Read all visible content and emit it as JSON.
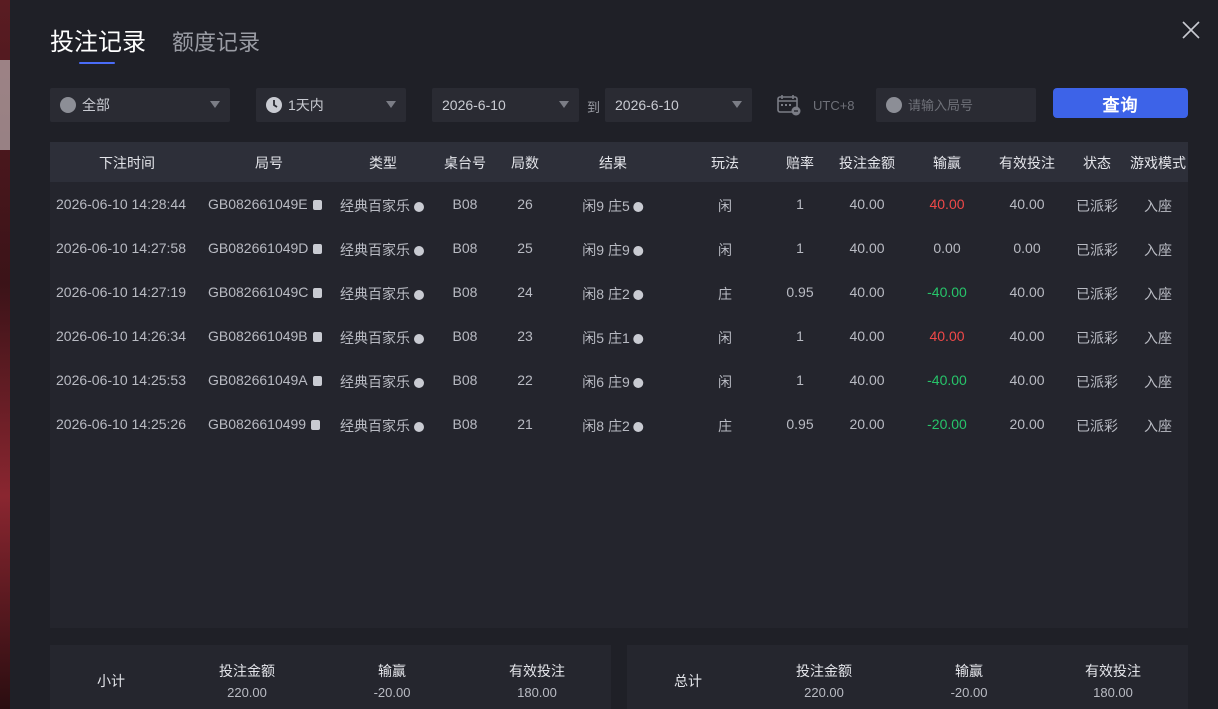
{
  "tabs": [
    {
      "label": "投注记录",
      "active": true
    },
    {
      "label": "额度记录",
      "active": false
    }
  ],
  "filters": {
    "category": "全部",
    "time_range": "1天内",
    "date_from": "2026-6-10",
    "to_label": "到",
    "date_to": "2026-6-10",
    "timezone": "UTC+8",
    "search_placeholder": "请输入局号",
    "query_label": "查询"
  },
  "table": {
    "columns": [
      "下注时间",
      "局号",
      "类型",
      "桌台号",
      "局数",
      "结果",
      "玩法",
      "赔率",
      "投注金额",
      "输赢",
      "有效投注",
      "状态",
      "游戏模式"
    ],
    "rows": [
      {
        "time": "2026-06-10 14:28:44",
        "round": "GB082661049E",
        "type": "经典百家乐",
        "table": "B08",
        "shoe": "26",
        "result": "闲9 庄5",
        "bet": "闲",
        "odds": "1",
        "amount": "40.00",
        "win": "40.00",
        "win_sign": "pos",
        "valid": "40.00",
        "status": "已派彩",
        "mode": "入座"
      },
      {
        "time": "2026-06-10 14:27:58",
        "round": "GB082661049D",
        "type": "经典百家乐",
        "table": "B08",
        "shoe": "25",
        "result": "闲9 庄9",
        "bet": "闲",
        "odds": "1",
        "amount": "40.00",
        "win": "0.00",
        "win_sign": "zero",
        "valid": "0.00",
        "status": "已派彩",
        "mode": "入座"
      },
      {
        "time": "2026-06-10 14:27:19",
        "round": "GB082661049C",
        "type": "经典百家乐",
        "table": "B08",
        "shoe": "24",
        "result": "闲8 庄2",
        "bet": "庄",
        "odds": "0.95",
        "amount": "40.00",
        "win": "-40.00",
        "win_sign": "neg",
        "valid": "40.00",
        "status": "已派彩",
        "mode": "入座"
      },
      {
        "time": "2026-06-10 14:26:34",
        "round": "GB082661049B",
        "type": "经典百家乐",
        "table": "B08",
        "shoe": "23",
        "result": "闲5 庄1",
        "bet": "闲",
        "odds": "1",
        "amount": "40.00",
        "win": "40.00",
        "win_sign": "pos",
        "valid": "40.00",
        "status": "已派彩",
        "mode": "入座"
      },
      {
        "time": "2026-06-10 14:25:53",
        "round": "GB082661049A",
        "type": "经典百家乐",
        "table": "B08",
        "shoe": "22",
        "result": "闲6 庄9",
        "bet": "闲",
        "odds": "1",
        "amount": "40.00",
        "win": "-40.00",
        "win_sign": "neg",
        "valid": "40.00",
        "status": "已派彩",
        "mode": "入座"
      },
      {
        "time": "2026-06-10 14:25:26",
        "round": "GB0826610499",
        "type": "经典百家乐",
        "table": "B08",
        "shoe": "21",
        "result": "闲8 庄2",
        "bet": "庄",
        "odds": "0.95",
        "amount": "20.00",
        "win": "-20.00",
        "win_sign": "neg",
        "valid": "20.00",
        "status": "已派彩",
        "mode": "入座"
      }
    ]
  },
  "subtotal": {
    "label": "小计",
    "amount_label": "投注金额",
    "amount": "220.00",
    "win_label": "输赢",
    "win": "-20.00",
    "valid_label": "有效投注",
    "valid": "180.00"
  },
  "total": {
    "label": "总计",
    "amount_label": "投注金额",
    "amount": "220.00",
    "win_label": "输赢",
    "win": "-20.00",
    "valid_label": "有效投注",
    "valid": "180.00"
  },
  "colors": {
    "accent": "#3d63e8",
    "win_positive": "#f04848",
    "win_negative": "#27c46a"
  },
  "icons": [
    "close-icon",
    "spade-icon",
    "clock-icon",
    "calendar-icon",
    "search-icon",
    "copy-icon",
    "play-icon",
    "info-icon"
  ]
}
